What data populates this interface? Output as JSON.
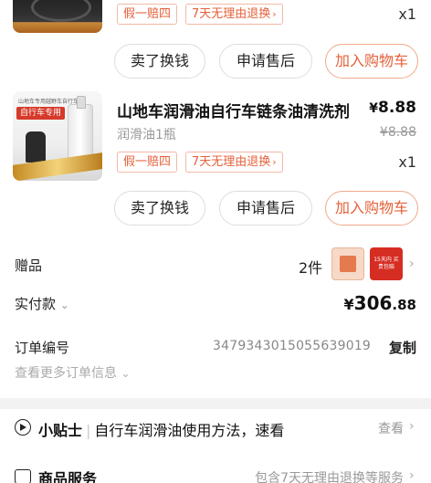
{
  "item1": {
    "qty": "x1",
    "tags": [
      "假一赔四",
      "7天无理由退换"
    ],
    "buttons": [
      "卖了换钱",
      "申请售后",
      "加入购物车"
    ]
  },
  "item2": {
    "title": "山地车润滑油自行车链条油清洗剂",
    "price_symbol": "¥",
    "price": "8.88",
    "spec": "润滑油1瓶",
    "original_price": "¥8.88",
    "qty": "x1",
    "tags": [
      "假一赔四",
      "7天无理由退换"
    ],
    "thumb_text_small": "山地车专用越野车自行车",
    "thumb_text_red": "自行车专用",
    "buttons": [
      "卖了换钱",
      "申请售后",
      "加入购物车"
    ]
  },
  "gifts": {
    "label": "赠品",
    "count": "2件",
    "gift2_text": "15天内 买贵包赔"
  },
  "paid": {
    "label": "实付款",
    "symbol": "¥",
    "int": "306",
    "dec": ".88"
  },
  "order": {
    "label": "订单编号",
    "number": "3479343015055639019",
    "copy_label": "复制",
    "more_label": "查看更多订单信息"
  },
  "tip": {
    "label": "小贴士",
    "text": "自行车润滑油使用方法，速看",
    "action": "查看"
  },
  "service": {
    "label": "商品服务",
    "detail": "包含7天无理由退换等服务"
  },
  "colors": {
    "accent": "#e5603a",
    "tag_border": "#f3b9a6"
  }
}
